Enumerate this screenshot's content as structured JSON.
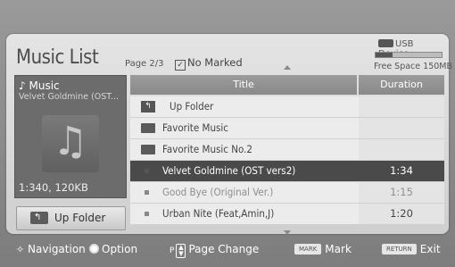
{
  "header": {
    "title": "Music List",
    "page": "Page 2/3",
    "no_marked": "No Marked",
    "usb_label": "USB Device",
    "free_space": "Free Space 150MB",
    "usb_fill": 0.25
  },
  "preview": {
    "heading": "Music",
    "track": "Velvet Goldmine (OST...",
    "size": "1:340, 120KB",
    "up_folder": "Up Folder"
  },
  "table": {
    "col_title": "Title",
    "col_duration": "Duration",
    "rows": [
      {
        "type": "up",
        "name": "Up Folder",
        "duration": ""
      },
      {
        "type": "folder",
        "name": "Favorite Music",
        "duration": ""
      },
      {
        "type": "folder",
        "name": "Favorite Music No.2",
        "duration": ""
      },
      {
        "type": "file",
        "name": "Velvet Goldmine (OST vers2)",
        "duration": "1:34",
        "selected": true
      },
      {
        "type": "file",
        "name": "Good Bye (Original Ver.)",
        "duration": "1:15",
        "dim": true
      },
      {
        "type": "file",
        "name": "Urban Nite (Feat,Amin,J)",
        "duration": "1:20"
      }
    ]
  },
  "footer": {
    "navigation": "Navigation",
    "option": "Option",
    "page_key": "P",
    "page_change": "Page Change",
    "mark_key": "MARK",
    "mark": "Mark",
    "return_key": "RETURN",
    "exit": "Exit"
  }
}
